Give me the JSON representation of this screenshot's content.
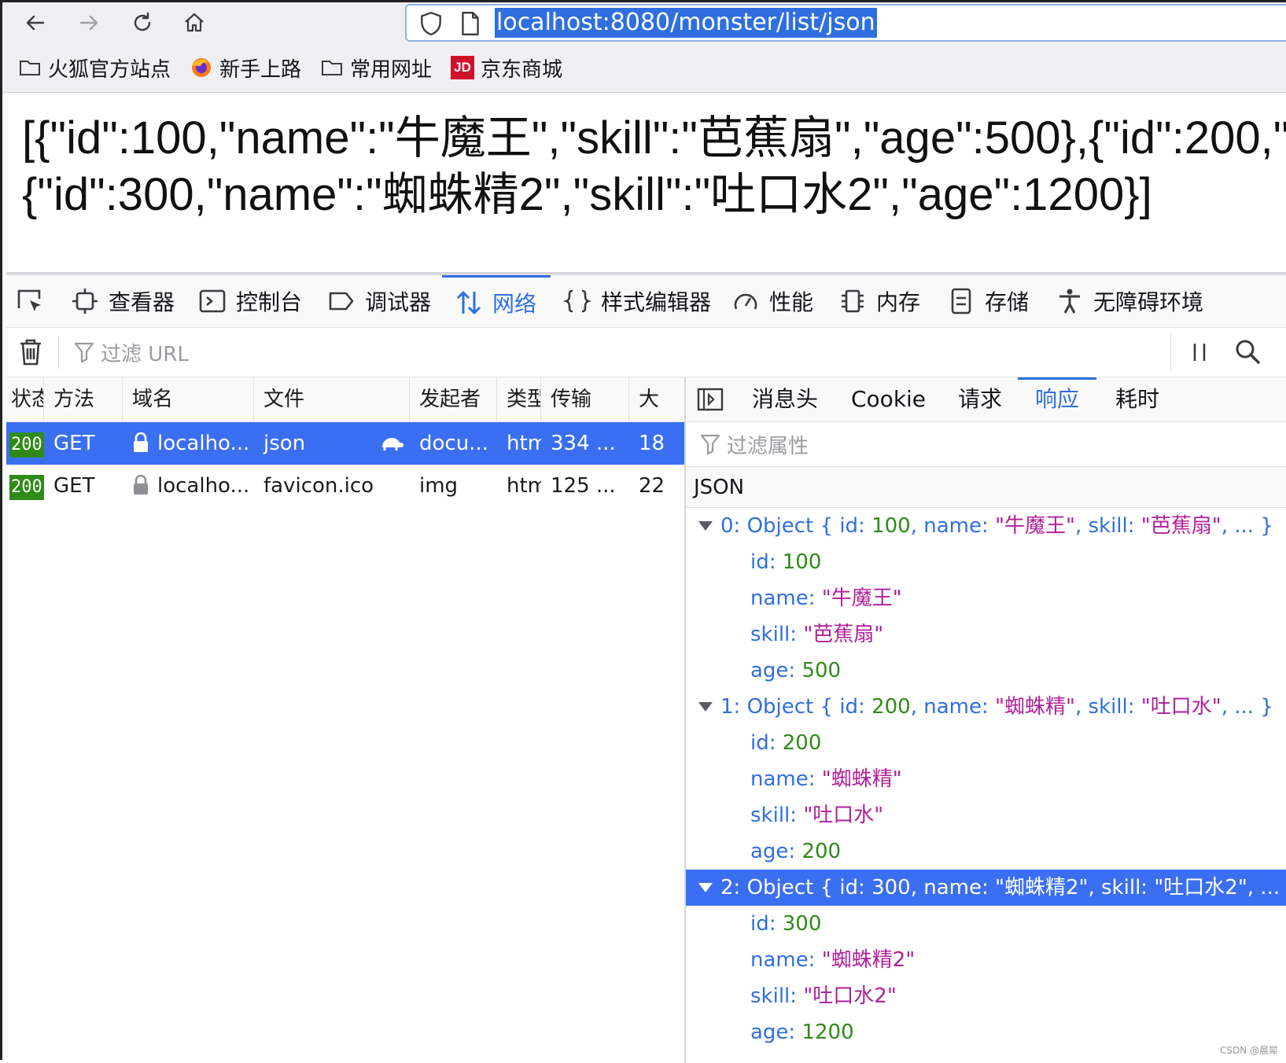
{
  "browser": {
    "url": "localhost:8080/monster/list/json",
    "bookmarks": [
      {
        "label": "火狐官方站点",
        "icon": "folder-icon"
      },
      {
        "label": "新手上路",
        "icon": "firefox-icon"
      },
      {
        "label": "常用网址",
        "icon": "folder-icon"
      },
      {
        "label": "京东商城",
        "icon": "jd-icon",
        "icon_text": "JD"
      }
    ]
  },
  "page": {
    "json_line1": "[{\"id\":100,\"name\":\"牛魔王\",\"skill\":\"芭蕉扇\",\"age\":500},{\"id\":200,\"",
    "json_line2": "{\"id\":300,\"name\":\"蜘蛛精2\",\"skill\":\"吐口水2\",\"age\":1200}]"
  },
  "devtools": {
    "tabs": [
      "查看器",
      "控制台",
      "调试器",
      "网络",
      "样式编辑器",
      "性能",
      "内存",
      "存储",
      "无障碍环境"
    ],
    "active_tab": "网络",
    "filter_url_placeholder": "过滤 URL",
    "columns": [
      "状态",
      "方法",
      "域名",
      "文件",
      "发起者",
      "类型",
      "传输",
      "大"
    ],
    "requests": [
      {
        "status": "200",
        "method": "GET",
        "domain": "localho...",
        "file": "json",
        "initiator": "docu...",
        "type": "htm",
        "transferred": "334 ...",
        "size": "18"
      },
      {
        "status": "200",
        "method": "GET",
        "domain": "localho...",
        "file": "favicon.ico",
        "initiator": "img",
        "type": "htm",
        "transferred": "125 ...",
        "size": "22"
      }
    ],
    "detail_tabs": [
      "消息头",
      "Cookie",
      "请求",
      "响应",
      "耗时"
    ],
    "active_detail_tab": "响应",
    "filter_props_placeholder": "过滤属性",
    "response_label": "JSON",
    "objects": [
      {
        "index": "0",
        "summary_prefix": "0: Object { id: ",
        "id": "100",
        "name": "\"牛魔王\"",
        "skill": "\"芭蕉扇\"",
        "age": "500",
        "summary_name": "\"牛魔王\"",
        "summary_skill": "\"芭蕉扇\""
      },
      {
        "index": "1",
        "summary_prefix": "1: Object { id: ",
        "id": "200",
        "name": "\"蜘蛛精\"",
        "skill": "\"吐口水\"",
        "age": "200",
        "summary_name": "\"蜘蛛精\"",
        "summary_skill": "\"吐口水\""
      },
      {
        "index": "2",
        "summary_prefix": "2: Object { id: ",
        "id": "300",
        "name": "\"蜘蛛精2\"",
        "skill": "\"吐口水2\"",
        "age": "1200",
        "summary_name": "\"蜘蛛精2\"",
        "summary_skill": "\"吐口水2\""
      }
    ],
    "labels": {
      "id": "id: ",
      "name": "name: ",
      "skill": "skill: ",
      "age": "age: ",
      "sum_name": ", name: ",
      "sum_skill": ", skill: ",
      "sum_end": ", ... }"
    }
  },
  "watermark": "CSDN @晨犀",
  "colors": {
    "accent": "#2f6fe0",
    "selection": "#3b6ff2",
    "status_ok": "#2e8b17",
    "string": "#b0209a"
  }
}
